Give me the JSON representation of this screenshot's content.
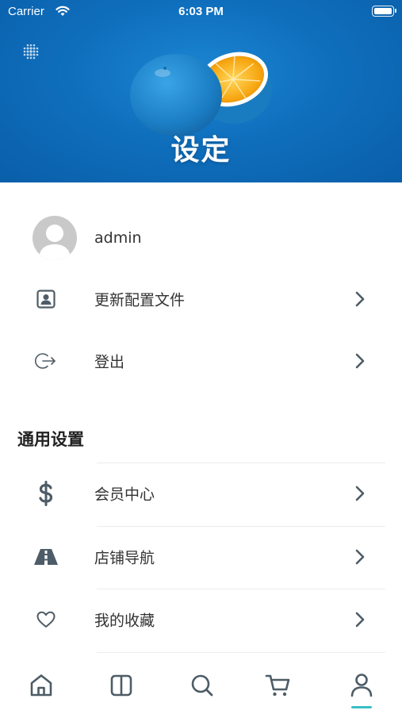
{
  "status_bar": {
    "carrier": "Carrier",
    "time": "6:03 PM"
  },
  "header": {
    "title": "设定"
  },
  "profile": {
    "username": "admin"
  },
  "account_items": [
    {
      "label": "更新配置文件",
      "icon": "profile-card-icon"
    },
    {
      "label": "登出",
      "icon": "logout-icon"
    }
  ],
  "general_section": {
    "title": "通用设置",
    "items": [
      {
        "label": "会员中心",
        "icon": "dollar-icon"
      },
      {
        "label": "店铺导航",
        "icon": "road-icon"
      },
      {
        "label": "我的收藏",
        "icon": "heart-icon"
      }
    ]
  },
  "tab_bar": {
    "tabs": [
      "home-icon",
      "book-icon",
      "search-icon",
      "cart-icon",
      "user-icon"
    ],
    "active": "user-icon"
  },
  "colors": {
    "hero_blue": "#0f6fbd",
    "icon_slate": "#4d5c66",
    "accent_teal": "#3bbfc4",
    "orange": "#f5a20f"
  }
}
